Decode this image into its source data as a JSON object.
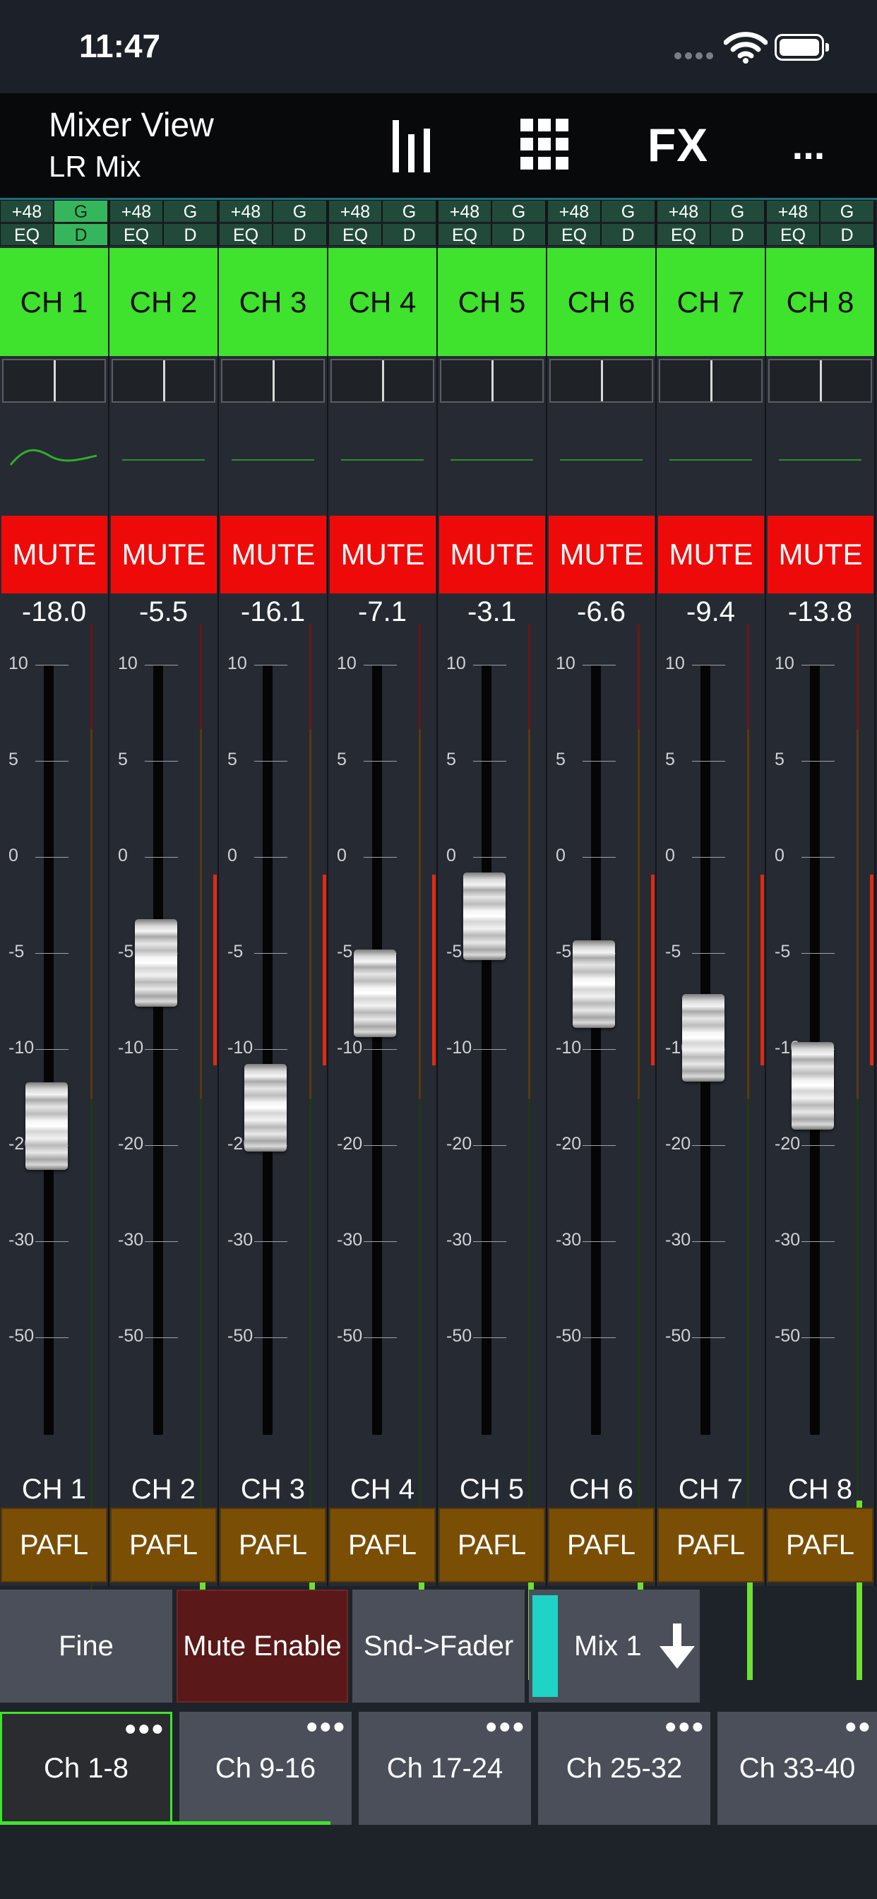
{
  "status_bar": {
    "time": "11:47",
    "icons": [
      "cellular-signal-icon",
      "wifi-icon",
      "battery-icon"
    ]
  },
  "header": {
    "title": "Mixer View",
    "subtitle": "LR Mix",
    "buttons": [
      {
        "name": "faders-view-icon"
      },
      {
        "name": "grid-view-icon"
      },
      {
        "name": "fx-button",
        "label": "FX"
      },
      {
        "name": "more-menu-button",
        "label": "..."
      }
    ]
  },
  "channel_tags": {
    "phantom": "+48",
    "gate": "G",
    "eq": "EQ",
    "dyn": "D"
  },
  "fader_scale": [
    "10",
    "5",
    "0",
    "-5",
    "-10",
    "-20",
    "-30",
    "-50"
  ],
  "channels": [
    {
      "name": "CH 1",
      "gain": "-18.0",
      "mute": "MUTE",
      "pafl": "PAFL",
      "level_db": -18.0,
      "pan": 0.5,
      "gate_on": true,
      "dyn_on": true,
      "eq_curve": true,
      "meter_fraction": 0.08
    },
    {
      "name": "CH 2",
      "gain": "-5.5",
      "mute": "MUTE",
      "pafl": "PAFL",
      "level_db": -5.5,
      "pan": 0.5,
      "gate_on": false,
      "dyn_on": false,
      "eq_curve": false,
      "meter_fraction": 0.1
    },
    {
      "name": "CH 3",
      "gain": "-16.1",
      "mute": "MUTE",
      "pafl": "PAFL",
      "level_db": -16.1,
      "pan": 0.5,
      "gate_on": false,
      "dyn_on": false,
      "eq_curve": false,
      "meter_fraction": 0.11
    },
    {
      "name": "CH 4",
      "gain": "-7.1",
      "mute": "MUTE",
      "pafl": "PAFL",
      "level_db": -7.1,
      "pan": 0.5,
      "gate_on": false,
      "dyn_on": false,
      "eq_curve": false,
      "meter_fraction": 0.13
    },
    {
      "name": "CH 5",
      "gain": "-3.1",
      "mute": "MUTE",
      "pafl": "PAFL",
      "level_db": -3.1,
      "pan": 0.5,
      "gate_on": false,
      "dyn_on": false,
      "eq_curve": false,
      "meter_fraction": 0.14
    },
    {
      "name": "CH 6",
      "gain": "-6.6",
      "mute": "MUTE",
      "pafl": "PAFL",
      "level_db": -6.6,
      "pan": 0.5,
      "gate_on": false,
      "dyn_on": false,
      "eq_curve": false,
      "meter_fraction": 0.15
    },
    {
      "name": "CH 7",
      "gain": "-9.4",
      "mute": "MUTE",
      "pafl": "PAFL",
      "level_db": -9.4,
      "pan": 0.5,
      "gate_on": false,
      "dyn_on": false,
      "eq_curve": false,
      "meter_fraction": 0.16
    },
    {
      "name": "CH 8",
      "gain": "-13.8",
      "mute": "MUTE",
      "pafl": "PAFL",
      "level_db": -13.8,
      "pan": 0.5,
      "gate_on": false,
      "dyn_on": false,
      "eq_curve": false,
      "meter_fraction": 0.17
    }
  ],
  "controls": {
    "fine": "Fine",
    "mute_enable": "Mute Enable",
    "snd_fader": "Snd->Fader",
    "mix": "Mix 1"
  },
  "banks": [
    {
      "label": "Ch 1-8",
      "dots": "●●●",
      "active": true
    },
    {
      "label": "Ch 9-16",
      "dots": "●●●",
      "active": false
    },
    {
      "label": "Ch 17-24",
      "dots": "●●●",
      "active": false
    },
    {
      "label": "Ch 25-32",
      "dots": "●●●",
      "active": false
    },
    {
      "label": "Ch 33-40",
      "dots": "●●",
      "active": false
    }
  ],
  "colors": {
    "channel_name_bg": "#3fe22d",
    "mute_bg": "#ef0a0a",
    "pafl_bg": "#7a4f05",
    "mix_selected": "#1fd3c6",
    "active_bank": "#3ee52c",
    "tag_on": "#36b65c",
    "tag_off": "#214a3b"
  }
}
